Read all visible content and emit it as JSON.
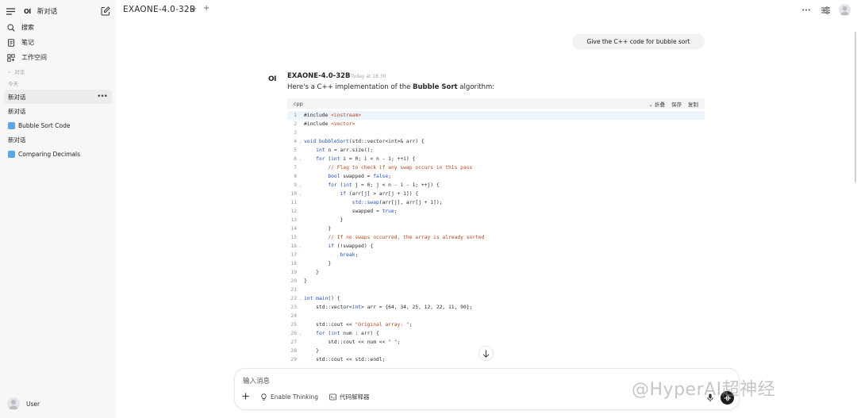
{
  "sidebar": {
    "logo": "OI",
    "new_chat": "新对话",
    "nav": [
      {
        "label": "搜索",
        "icon": "search-icon"
      },
      {
        "label": "笔记",
        "icon": "notes-icon"
      },
      {
        "label": "工作空间",
        "icon": "workspace-icon"
      }
    ],
    "section": "对话",
    "today": "今天",
    "chats": [
      {
        "label": "新对话",
        "active": true
      },
      {
        "label": "新对话",
        "active": false
      },
      {
        "label": "Bubble Sort Code",
        "active": false,
        "icon_color": "#5aa6e6"
      },
      {
        "label": "新对话",
        "active": false
      },
      {
        "label": "Comparing Decimals",
        "active": false,
        "icon_color": "#5aa6e6"
      }
    ],
    "user": "User"
  },
  "header": {
    "model": "EXAONE-4.0-32B",
    "plus": "+"
  },
  "conversation": {
    "user_message": "Give the C++ code for bubble sort",
    "assistant_logo": "OI",
    "assistant_name": "EXAONE-4.0-32B",
    "assistant_time": "Today at 18:30",
    "intro_before": "Here's a C++ implementation of the ",
    "intro_bold": "Bubble Sort",
    "intro_after": " algorithm:"
  },
  "code_block": {
    "language": "cpp",
    "actions": [
      "折叠",
      "保存",
      "复制"
    ],
    "lines": [
      {
        "n": "1",
        "fold": false,
        "segs": [
          [
            "",
            "#include "
          ],
          [
            "str",
            "<iostream>"
          ]
        ]
      },
      {
        "n": "2",
        "fold": false,
        "segs": [
          [
            "",
            "#include "
          ],
          [
            "str",
            "<vector>"
          ]
        ]
      },
      {
        "n": "3",
        "fold": false,
        "segs": []
      },
      {
        "n": "4",
        "fold": true,
        "segs": [
          [
            "kw",
            "void bubbleSort"
          ],
          [
            "",
            "(std::vector<int>& arr) {"
          ]
        ]
      },
      {
        "n": "5",
        "fold": false,
        "segs": [
          [
            "",
            "    "
          ],
          [
            "kw",
            "int"
          ],
          [
            "",
            " n = arr.size();"
          ]
        ]
      },
      {
        "n": "6",
        "fold": true,
        "segs": [
          [
            "",
            "    "
          ],
          [
            "kw",
            "for"
          ],
          [
            "",
            " ("
          ],
          [
            "kw",
            "int"
          ],
          [
            "",
            " i = 0; i < n - 1; ++i) {"
          ]
        ]
      },
      {
        "n": "7",
        "fold": false,
        "segs": [
          [
            "",
            "        "
          ],
          [
            "cm",
            "// Flag to check if any swap occurs in this pass"
          ]
        ]
      },
      {
        "n": "8",
        "fold": false,
        "segs": [
          [
            "",
            "        "
          ],
          [
            "kw",
            "bool"
          ],
          [
            "",
            " swapped = "
          ],
          [
            "kw",
            "false"
          ],
          [
            "",
            ";"
          ]
        ]
      },
      {
        "n": "9",
        "fold": true,
        "segs": [
          [
            "",
            "        "
          ],
          [
            "kw",
            "for"
          ],
          [
            "",
            " ("
          ],
          [
            "kw",
            "int"
          ],
          [
            "",
            " j = 0; j < n - i - 1; ++j) {"
          ]
        ]
      },
      {
        "n": "10",
        "fold": true,
        "segs": [
          [
            "",
            "            "
          ],
          [
            "kw",
            "if"
          ],
          [
            "",
            " (arr[j] > arr[j + 1]) {"
          ]
        ]
      },
      {
        "n": "11",
        "fold": false,
        "segs": [
          [
            "",
            "                "
          ],
          [
            "kw",
            "std::swap"
          ],
          [
            "",
            "(arr[j], arr[j + 1]);"
          ]
        ]
      },
      {
        "n": "12",
        "fold": false,
        "segs": [
          [
            "",
            "                swapped = "
          ],
          [
            "kw",
            "true"
          ],
          [
            "",
            ";"
          ]
        ]
      },
      {
        "n": "13",
        "fold": false,
        "segs": [
          [
            "",
            "            }"
          ]
        ]
      },
      {
        "n": "14",
        "fold": false,
        "segs": [
          [
            "",
            "        }"
          ]
        ]
      },
      {
        "n": "15",
        "fold": false,
        "segs": [
          [
            "",
            "        "
          ],
          [
            "cm",
            "// If no swaps occurred, the array is already sorted"
          ]
        ]
      },
      {
        "n": "16",
        "fold": true,
        "segs": [
          [
            "",
            "        "
          ],
          [
            "kw",
            "if"
          ],
          [
            "",
            " (!swapped) {"
          ]
        ]
      },
      {
        "n": "17",
        "fold": false,
        "segs": [
          [
            "",
            "            "
          ],
          [
            "kw",
            "break"
          ],
          [
            "",
            ";"
          ]
        ]
      },
      {
        "n": "18",
        "fold": false,
        "segs": [
          [
            "",
            "        }"
          ]
        ]
      },
      {
        "n": "19",
        "fold": false,
        "segs": [
          [
            "",
            "    }"
          ]
        ]
      },
      {
        "n": "20",
        "fold": false,
        "segs": [
          [
            "",
            "}"
          ]
        ]
      },
      {
        "n": "21",
        "fold": false,
        "segs": []
      },
      {
        "n": "22",
        "fold": true,
        "segs": [
          [
            "kw",
            "int main"
          ],
          [
            "",
            "() {"
          ]
        ]
      },
      {
        "n": "23",
        "fold": false,
        "segs": [
          [
            "",
            "    std::vector<"
          ],
          [
            "kw",
            "int"
          ],
          [
            "",
            "> arr = {64, 34, 25, 12, 22, 11, 90};"
          ]
        ]
      },
      {
        "n": "24",
        "fold": false,
        "segs": []
      },
      {
        "n": "25",
        "fold": false,
        "segs": [
          [
            "",
            "    std::cout << "
          ],
          [
            "str",
            "\"Original array: \""
          ],
          [
            "",
            ";"
          ]
        ]
      },
      {
        "n": "26",
        "fold": true,
        "segs": [
          [
            "",
            "    "
          ],
          [
            "kw",
            "for"
          ],
          [
            "",
            " ("
          ],
          [
            "kw",
            "int"
          ],
          [
            "",
            " num : arr) {"
          ]
        ]
      },
      {
        "n": "27",
        "fold": false,
        "segs": [
          [
            "",
            "        std::cout << num << "
          ],
          [
            "str",
            "\" \""
          ],
          [
            "",
            ";"
          ]
        ]
      },
      {
        "n": "28",
        "fold": false,
        "segs": [
          [
            "",
            "    }"
          ]
        ]
      },
      {
        "n": "29",
        "fold": false,
        "segs": [
          [
            "",
            "    std::cout << std::endl;"
          ]
        ]
      }
    ]
  },
  "input": {
    "placeholder": "输入消息",
    "tools": [
      {
        "label": "Enable Thinking",
        "icon": "lightbulb-icon"
      },
      {
        "label": "代码解释器",
        "icon": "code-interpreter-icon"
      }
    ]
  },
  "watermark": "@HyperAI超神经"
}
